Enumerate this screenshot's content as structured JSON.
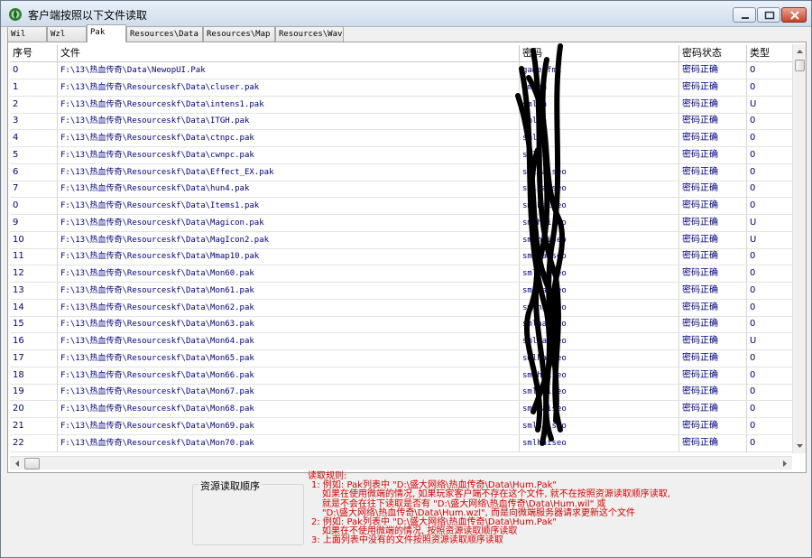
{
  "window": {
    "title": "客户端按照以下文件读取",
    "controls": {
      "minimize": "minimize",
      "maximize": "maximize",
      "close": "close"
    }
  },
  "tabs": [
    {
      "label": "Wil",
      "active": false
    },
    {
      "label": "Wzl",
      "active": false
    },
    {
      "label": "Pak",
      "active": true
    },
    {
      "label": "Resources\\Data",
      "active": false
    },
    {
      "label": "Resources\\Map",
      "active": false
    },
    {
      "label": "Resources\\Wav",
      "active": false
    }
  ],
  "table": {
    "columns": [
      "序号",
      "文件",
      "密码",
      "密码状态",
      "类型"
    ],
    "rows": [
      [
        "0",
        "F:\\13\\热血传奇\\Data\\NewopUI.Pak",
        "gameofmi",
        "密码正确",
        "0"
      ],
      [
        "1",
        "F:\\13\\热血传奇\\Resourceskf\\Data\\cluser.pak",
        "smlha",
        "密码正确",
        "0"
      ],
      [
        "2",
        "F:\\13\\热血传奇\\Resourceskf\\Data\\intens1.pak",
        "smlha",
        "密码正确",
        "U"
      ],
      [
        "3",
        "F:\\13\\热血传奇\\Resourceskf\\Data\\ITGH.pak",
        "smlha",
        "密码正确",
        "0"
      ],
      [
        "4",
        "F:\\13\\热血传奇\\Resourceskf\\Data\\ctnpc.pak",
        "smlha",
        "密码正确",
        "0"
      ],
      [
        "5",
        "F:\\13\\热血传奇\\Resourceskf\\Data\\cwnpc.pak",
        "smlha",
        "密码正确",
        "0"
      ],
      [
        "6",
        "F:\\13\\热血传奇\\Resourceskf\\Data\\Effect_EX.pak",
        "smlhaiseo",
        "密码正确",
        "0"
      ],
      [
        "7",
        "F:\\13\\热血传奇\\Resourceskf\\Data\\hun4.pak",
        "smlhaiseo",
        "密码正确",
        "0"
      ],
      [
        "0",
        "F:\\13\\热血传奇\\Resourceskf\\Data\\Items1.pak",
        "smlhaiseo",
        "密码正确",
        "0"
      ],
      [
        "9",
        "F:\\13\\热血传奇\\Resourceskf\\Data\\Magicon.pak",
        "smlhaiseo",
        "密码正确",
        "U"
      ],
      [
        "10",
        "F:\\13\\热血传奇\\Resourceskf\\Data\\MagIcon2.pak",
        "smlhaiseo",
        "密码正确",
        "U"
      ],
      [
        "11",
        "F:\\13\\热血传奇\\Resourceskf\\Data\\Mmap10.pak",
        "smlhaiseo",
        "密码正确",
        "0"
      ],
      [
        "12",
        "F:\\13\\热血传奇\\Resourceskf\\Data\\Mon60.pak",
        "smlhaiseo",
        "密码正确",
        "0"
      ],
      [
        "13",
        "F:\\13\\热血传奇\\Resourceskf\\Data\\Mon61.pak",
        "smlhaiseo",
        "密码正确",
        "0"
      ],
      [
        "14",
        "F:\\13\\热血传奇\\Resourceskf\\Data\\Mon62.pak",
        "smlhaiseo",
        "密码正确",
        "0"
      ],
      [
        "15",
        "F:\\13\\热血传奇\\Resourceskf\\Data\\Mon63.pak",
        "smlhaiseo",
        "密码正确",
        "0"
      ],
      [
        "16",
        "F:\\13\\热血传奇\\Resourceskf\\Data\\Mon64.pak",
        "smlhaiseo",
        "密码正确",
        "U"
      ],
      [
        "17",
        "F:\\13\\热血传奇\\Resourceskf\\Data\\Mon65.pak",
        "smlhaiseo",
        "密码正确",
        "0"
      ],
      [
        "18",
        "F:\\13\\热血传奇\\Resourceskf\\Data\\Mon66.pak",
        "smlhaiseo",
        "密码正确",
        "0"
      ],
      [
        "19",
        "F:\\13\\热血传奇\\Resourceskf\\Data\\Mon67.pak",
        "smlhaiseo",
        "密码正确",
        "0"
      ],
      [
        "20",
        "F:\\13\\热血传奇\\Resourceskf\\Data\\Mon68.pak",
        "smlhaiseo",
        "密码正确",
        "0"
      ],
      [
        "21",
        "F:\\13\\热血传奇\\Resourceskf\\Data\\Mon69.pak",
        "smlhaiseo",
        "密码正确",
        "0"
      ],
      [
        "22",
        "F:\\13\\热血传奇\\Resourceskf\\Data\\Mon70.pak",
        "smlhaiseo",
        "密码正确",
        "0"
      ]
    ]
  },
  "load_order_group": {
    "title": "资源读取顺序"
  },
  "notes": {
    "title": "读取规则:",
    "lines": [
      "1: 例如: Pak列表中 \"D:\\盛大网络\\热血传奇\\Data\\Hum.Pak\"",
      "如果在使用微端的情况, 如果玩家客户端不存在这个文件, 就不在按照资源读取顺序读取,",
      "就是不会在往下读取是否有 \"D:\\盛大网络\\热血传奇\\Data\\Hum.wil\" 或",
      "\"D:\\盛大网络\\热血传奇\\Data\\Hum.wzl\", 而是向微端服务器请求更新这个文件",
      "2: 例如: Pak列表中 \"D:\\盛大网络\\热血传奇\\Data\\Hum.Pak\"",
      "如果在不使用微端的情况, 按照资源读取顺序读取",
      "3: 上面列表中没有的文件按照资源读取顺序读取"
    ]
  },
  "colors": {
    "cell_text": "#000080",
    "notes_text": "#d40000",
    "window_bg": "#f0f0f0"
  }
}
